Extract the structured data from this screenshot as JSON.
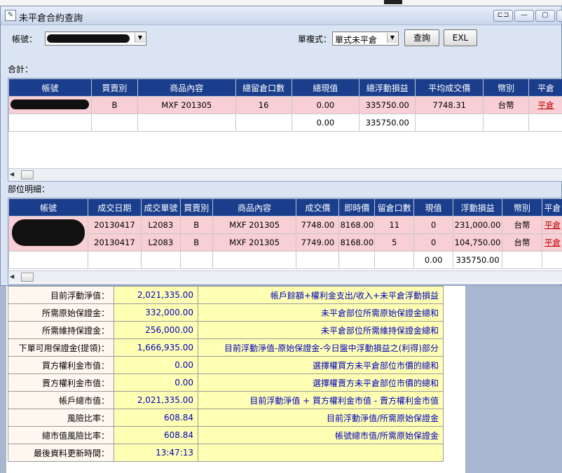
{
  "window": {
    "title": "未平倉合約查詢",
    "buttons": [
      "⊏⊐",
      "—",
      "▢",
      "✕"
    ]
  },
  "toolbar": {
    "account_label": "帳號：",
    "mode_label": "單複式：",
    "mode_value": "單式未平倉",
    "query_label": "查詢",
    "excel_label": "EXL"
  },
  "totals": {
    "section_label": "合計：",
    "columns": [
      "帳號",
      "買賣別",
      "商品內容",
      "總留倉口數",
      "總現值",
      "總浮動損益",
      "平均成交價",
      "幣別",
      "平倉"
    ],
    "rows": [
      {
        "buysell": "B",
        "product": "MXF 201305",
        "qty": "16",
        "value": "0.00",
        "pnl": "335750.00",
        "avg": "7748.31",
        "currency": "台幣",
        "action": "平倉"
      },
      {
        "buysell": "",
        "product": "",
        "qty": "",
        "value": "0.00",
        "pnl": "335750.00",
        "avg": "",
        "currency": "",
        "action": ""
      }
    ]
  },
  "details": {
    "section_label": "部位明細：",
    "columns": [
      "帳號",
      "成交日期",
      "成交單號",
      "買賣別",
      "商品內容",
      "成交價",
      "即時價",
      "留倉口數",
      "現值",
      "浮動損益",
      "幣別",
      "平倉"
    ],
    "rows": [
      {
        "date": "20130417",
        "order": "L2083",
        "buysell": "B",
        "product": "MXF 201305",
        "price": "7748.00",
        "last": "8168.00",
        "qty": "11",
        "value": "0",
        "pnl": "231,000.00",
        "currency": "台幣",
        "action": "平倉"
      },
      {
        "date": "20130417",
        "order": "L2083",
        "buysell": "B",
        "product": "MXF 201305",
        "price": "7749.00",
        "last": "8168.00",
        "qty": "5",
        "value": "0",
        "pnl": "104,750.00",
        "currency": "台幣",
        "action": "平倉"
      },
      {
        "date": "",
        "order": "",
        "buysell": "",
        "product": "",
        "price": "",
        "last": "",
        "qty": "",
        "value": "0.00",
        "pnl": "335750.00",
        "currency": "",
        "action": ""
      }
    ]
  },
  "summary": [
    {
      "label": "目前浮動淨值：",
      "value": "2,021,335.00",
      "desc": "帳戶餘額+權利金支出/收入+未平倉浮動損益"
    },
    {
      "label": "所需原始保證金：",
      "value": "332,000.00",
      "desc": "未平倉部位所需原始保證金總和"
    },
    {
      "label": "所需維持保證金：",
      "value": "256,000.00",
      "desc": "未平倉部位所需維持保證金總和"
    },
    {
      "label": "下單可用保證金(提領)：",
      "value": "1,666,935.00",
      "desc": "目前浮動淨值-原始保證金-今日盤中浮動損益之(利得)部分"
    },
    {
      "label": "買方權利金市值：",
      "value": "0.00",
      "desc": "選擇權買方未平倉部位市價的總和"
    },
    {
      "label": "賣方權利金市值：",
      "value": "0.00",
      "desc": "選擇權賣方未平倉部位市價的總和"
    },
    {
      "label": "帳戶總市值：",
      "value": "2,021,335.00",
      "desc": "目前浮動淨值 + 買方權利金市值 - 賣方權利金市值"
    },
    {
      "label": "風險比率：",
      "value": "608.84",
      "desc": "目前浮動淨值/所需原始保證金"
    },
    {
      "label": "總市值風險比率：",
      "value": "608.84",
      "desc": "帳號總市值/所需原始保證金"
    },
    {
      "label": "最後資料更新時間：",
      "value": "13:47:13",
      "desc": ""
    }
  ],
  "colors": {
    "header_bg": "#1a3d8c",
    "pink_row": "#f7cfd4",
    "summary_yellow": "#ffffb4",
    "summary_blue_text": "#0000b8"
  }
}
